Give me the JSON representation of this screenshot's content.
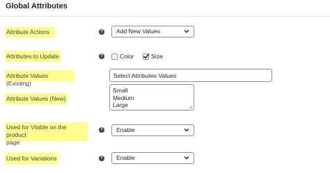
{
  "section_title": "Global Attributes",
  "rows": {
    "actions": {
      "label": "Attribute Actions",
      "value": "Add New Values"
    },
    "update": {
      "label": "Attributes to Update",
      "options": [
        {
          "label": "Color",
          "checked": false
        },
        {
          "label": "Size",
          "checked": true
        }
      ]
    },
    "existing": {
      "label": "Attribute Values (Existing)",
      "placeholder": "Select Attributes Values"
    },
    "new_values": {
      "label": "Attribute Values (New)",
      "lines": [
        "Small",
        "Medium",
        "Large"
      ]
    },
    "visible": {
      "label_line1": "Used for Visible on the product",
      "label_line2": "page",
      "value": "Enable"
    },
    "variations": {
      "label": "Used for Variations",
      "value": "Enable"
    }
  },
  "help_glyph": "?",
  "colors": {
    "highlight": "#ffff8e",
    "border": "#8c8f94",
    "help_icon": "#3c434a"
  }
}
